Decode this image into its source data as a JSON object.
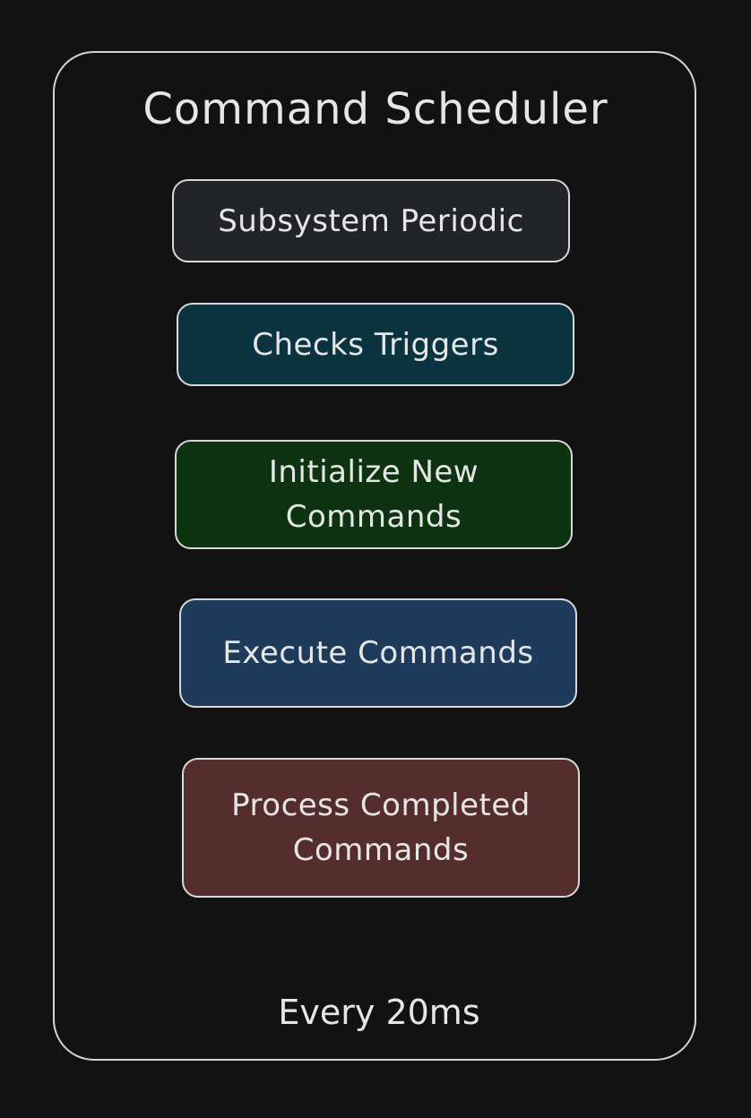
{
  "title": "Command Scheduler",
  "steps": [
    {
      "label": "Subsystem Periodic",
      "color": "#232427"
    },
    {
      "label": "Checks Triggers",
      "color": "#0b3440"
    },
    {
      "label": "Initialize New\nCommands",
      "color": "#0d3310"
    },
    {
      "label": "Execute Commands",
      "color": "#1e3b5c"
    },
    {
      "label": "Process Completed\nCommands",
      "color": "#552d2d"
    }
  ],
  "footer": "Every 20ms",
  "colors": {
    "background": "#121212",
    "border": "#d6d6d6",
    "text": "#e6e6e6"
  }
}
